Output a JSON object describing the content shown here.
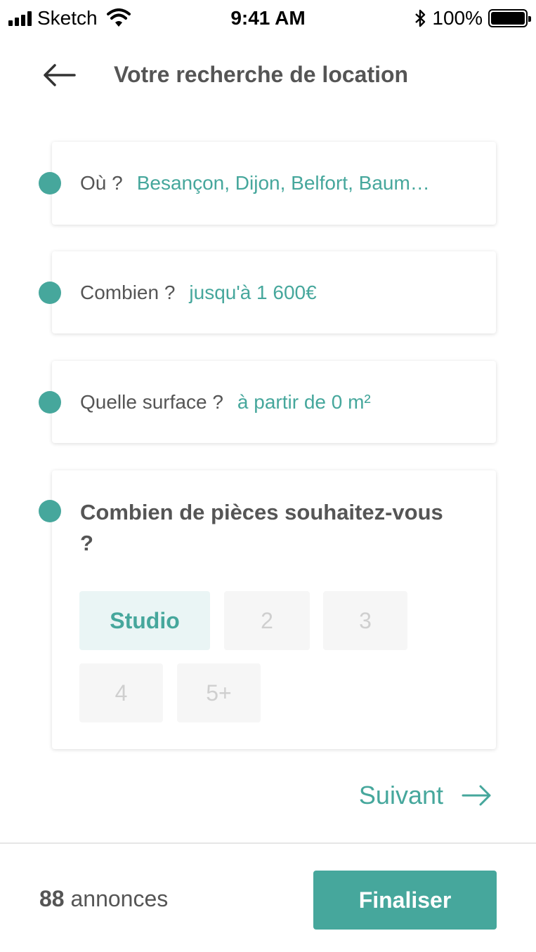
{
  "status_bar": {
    "carrier": "Sketch",
    "time": "9:41 AM",
    "battery": "100%"
  },
  "header": {
    "title": "Votre recherche de location",
    "back_icon": "arrow-left-icon"
  },
  "criteria": [
    {
      "label": "Où ?",
      "value": "Besançon, Dijon, Belfort, Baum…"
    },
    {
      "label": "Combien ?",
      "value": "jusqu'à 1 600€"
    },
    {
      "label": "Quelle surface ?",
      "value": "à partir de 0 m²"
    }
  ],
  "rooms": {
    "question": "Combien de pièces souhaitez-vous ?",
    "options": [
      "Studio",
      "2",
      "3",
      "4",
      "5+"
    ],
    "selected": "Studio"
  },
  "next": {
    "label": "Suivant",
    "icon": "arrow-right-icon"
  },
  "footer": {
    "count": "88",
    "count_label": "annonces",
    "finalize": "Finaliser"
  },
  "colors": {
    "accent": "#46a79c",
    "text": "#555555",
    "chip_selected_bg": "#eaf5f5",
    "chip_bg": "#f6f6f6"
  }
}
